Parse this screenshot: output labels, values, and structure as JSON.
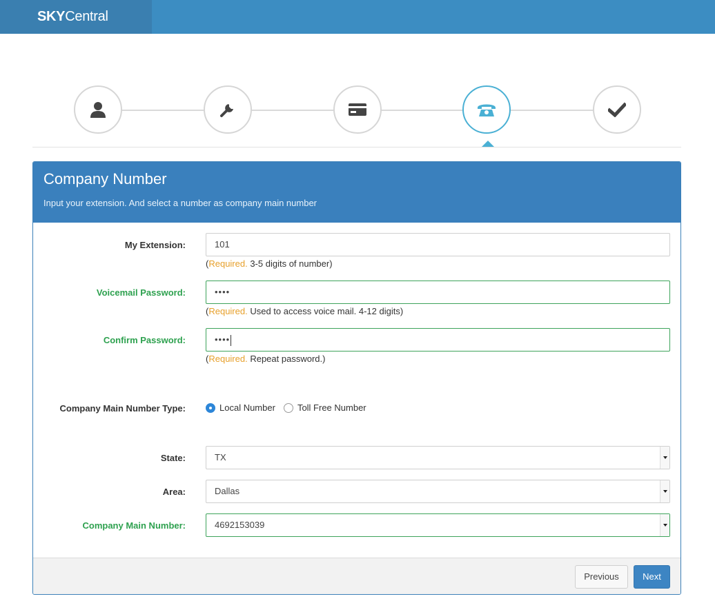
{
  "brand": {
    "bold": "SKY",
    "light": "Central"
  },
  "steps": [
    {
      "name": "user",
      "icon": "user-icon",
      "state": "done"
    },
    {
      "name": "settings",
      "icon": "wrench-icon",
      "state": "done"
    },
    {
      "name": "payment",
      "icon": "credit-card-icon",
      "state": "done"
    },
    {
      "name": "phone",
      "icon": "phone-icon",
      "state": "active"
    },
    {
      "name": "finish",
      "icon": "checkmark-icon",
      "state": "pending"
    }
  ],
  "panel": {
    "title": "Company Number",
    "subtitle": "Input your extension. And select a number as company main number"
  },
  "form": {
    "extension": {
      "label": "My Extension:",
      "value": "101",
      "req": "Required.",
      "help": " 3-5 digits of number)"
    },
    "voicemail": {
      "label": "Voicemail Password:",
      "value": "••••",
      "req": "Required.",
      "help": " Used to access voice mail. 4-12 digits)"
    },
    "confirm": {
      "label": "Confirm Password:",
      "value": "••••",
      "req": "Required.",
      "help": " Repeat password.)"
    },
    "number_type": {
      "label": "Company Main Number Type:",
      "options": [
        "Local Number",
        "Toll Free Number"
      ],
      "selected": "Local Number"
    },
    "state": {
      "label": "State:",
      "value": "TX"
    },
    "area": {
      "label": "Area:",
      "value": "Dallas"
    },
    "main_number": {
      "label": "Company Main Number:",
      "value": "4692153039"
    }
  },
  "paren_open": "(",
  "buttons": {
    "previous": "Previous",
    "next": "Next"
  },
  "colors": {
    "topbar": "#3c8dc2",
    "panel_header": "#3a80bd",
    "valid": "#2ea14f",
    "required": "#e7a02b",
    "active_step": "#4ab0d4"
  }
}
